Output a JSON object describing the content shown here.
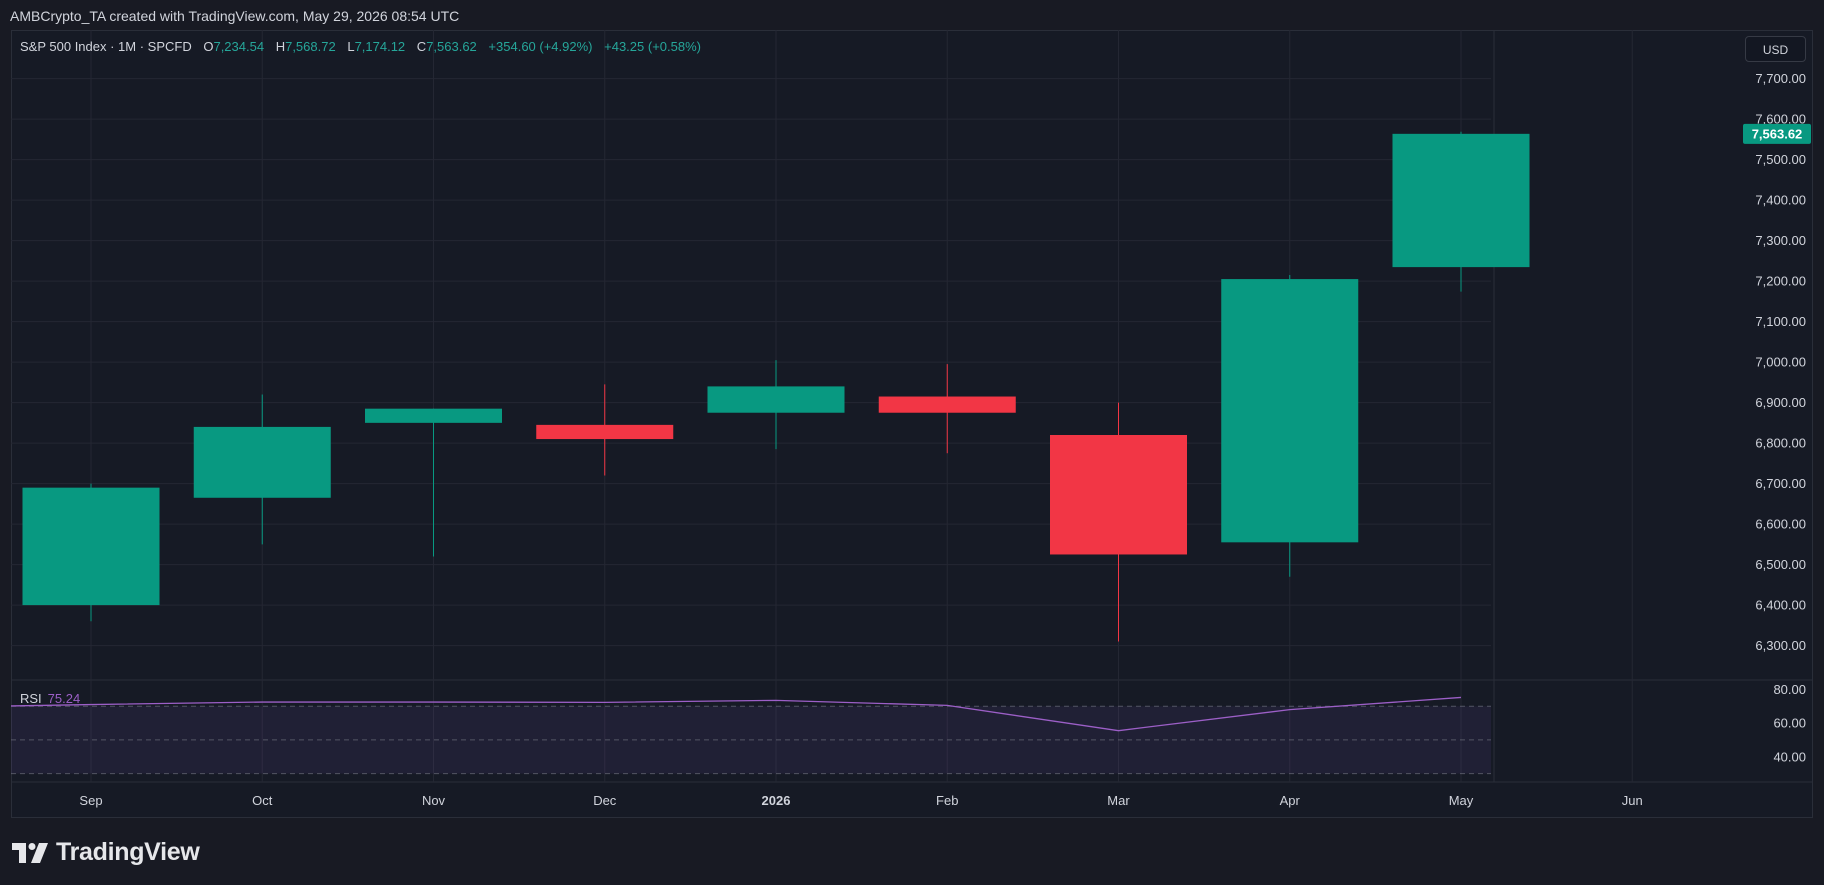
{
  "header": {
    "attribution": "AMBCrypto_TA created with TradingView.com, May 29, 2026 08:54 UTC"
  },
  "legend": {
    "symbol": "S&P 500 Index · 1M · SPCFD",
    "open_label": "O",
    "open": "7,234.54",
    "high_label": "H",
    "high": "7,568.72",
    "low_label": "L",
    "low": "7,174.12",
    "close_label": "C",
    "close": "7,563.62",
    "change": "+354.60 (+4.92%)",
    "change2": "+43.25 (+0.58%)"
  },
  "currency_button": "USD",
  "price_badge": "7,563.62",
  "rsi_legend": {
    "name": "RSI",
    "value": "75.24"
  },
  "brand": {
    "name": "TradingView"
  },
  "colors": {
    "up": "#089981",
    "down": "#f23645",
    "rsi": "#9c5fc7",
    "background": "#161a25",
    "grid": "#242733"
  },
  "chart_data": [
    {
      "type": "candlestick",
      "title": "S&P 500 Index · 1M · SPCFD",
      "x_labels": [
        "Sep",
        "Oct",
        "Nov",
        "Dec",
        "2026",
        "Feb",
        "Mar",
        "Apr",
        "May",
        "Jun"
      ],
      "candles": [
        {
          "month": "Sep",
          "open": 6400,
          "high": 6700,
          "low": 6360,
          "close": 6690
        },
        {
          "month": "Oct",
          "open": 6665,
          "high": 6920,
          "low": 6550,
          "close": 6840
        },
        {
          "month": "Nov",
          "open": 6850,
          "high": 6885,
          "low": 6520,
          "close": 6885
        },
        {
          "month": "Dec",
          "open": 6845,
          "high": 6945,
          "low": 6720,
          "close": 6810
        },
        {
          "month": "Jan",
          "open": 6875,
          "high": 7005,
          "low": 6785,
          "close": 6940
        },
        {
          "month": "Feb",
          "open": 6915,
          "high": 6995,
          "low": 6775,
          "close": 6875
        },
        {
          "month": "Mar",
          "open": 6820,
          "high": 6900,
          "low": 6310,
          "close": 6525
        },
        {
          "month": "Apr",
          "open": 6555,
          "high": 7215,
          "low": 6470,
          "close": 7205
        },
        {
          "month": "May",
          "open": 7234.54,
          "high": 7568.72,
          "low": 7174.12,
          "close": 7563.62
        }
      ],
      "y_ticks": [
        "7,700.00",
        "7,600.00",
        "7,500.00",
        "7,400.00",
        "7,300.00",
        "7,200.00",
        "7,100.00",
        "7,000.00",
        "6,900.00",
        "6,800.00",
        "6,700.00",
        "6,600.00",
        "6,500.00",
        "6,400.00",
        "6,300.00"
      ],
      "ylim": [
        6220,
        7820
      ],
      "grid": true
    },
    {
      "type": "line",
      "title": "RSI",
      "values": [
        71,
        72.5,
        72.5,
        72.3,
        73.5,
        70.5,
        55.5,
        68,
        75.24
      ],
      "y_ticks": [
        "80.00",
        "60.00",
        "40.00"
      ],
      "bands": [
        30,
        70
      ],
      "ylim": [
        25,
        85
      ]
    }
  ]
}
